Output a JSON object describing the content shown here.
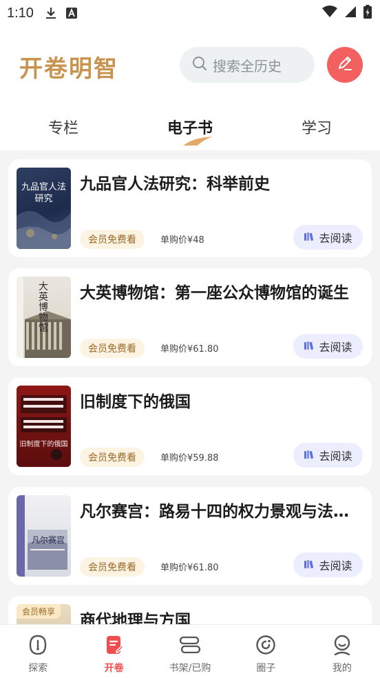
{
  "status_bar": {
    "time": "1:10"
  },
  "header": {
    "logo": "开卷明智",
    "search_placeholder": "搜索全历史"
  },
  "tabs": [
    {
      "label": "专栏"
    },
    {
      "label": "电子书",
      "active": true
    },
    {
      "label": "学习"
    }
  ],
  "books": [
    {
      "title": "九品官人法研究：科举前史",
      "badge": "会员免费看",
      "price": "单购价¥48",
      "action": "去阅读",
      "cover_text": "九品官人法研究"
    },
    {
      "title": "大英博物馆：第一座公众博物馆的诞生",
      "badge": "会员免费看",
      "price": "单购价¥61.80",
      "action": "去阅读",
      "cover_text": "大英博物馆"
    },
    {
      "title": "旧制度下的俄国",
      "badge": "会员免费看",
      "price": "单购价¥59.88",
      "action": "去阅读",
      "cover_text": "旧制度下的俄国"
    },
    {
      "title": "凡尔赛宫：路易十四的权力景观与法国的",
      "badge": "会员免费看",
      "price": "单购价¥61.80",
      "action": "去阅读",
      "cover_text": "凡尔赛宫"
    },
    {
      "title": "商代地理与方国",
      "badge": "会员畅享",
      "price": "",
      "action": "",
      "cover_text": ""
    }
  ],
  "bottom_nav": [
    {
      "label": "探索"
    },
    {
      "label": "开卷",
      "active": true
    },
    {
      "label": "书架/已购"
    },
    {
      "label": "圈子"
    },
    {
      "label": "我的"
    }
  ],
  "colors": {
    "accent": "#f26060",
    "logo": "#c8924f",
    "vip_badge_bg": "#fdf3e3",
    "read_button_bg": "#eceeff"
  }
}
